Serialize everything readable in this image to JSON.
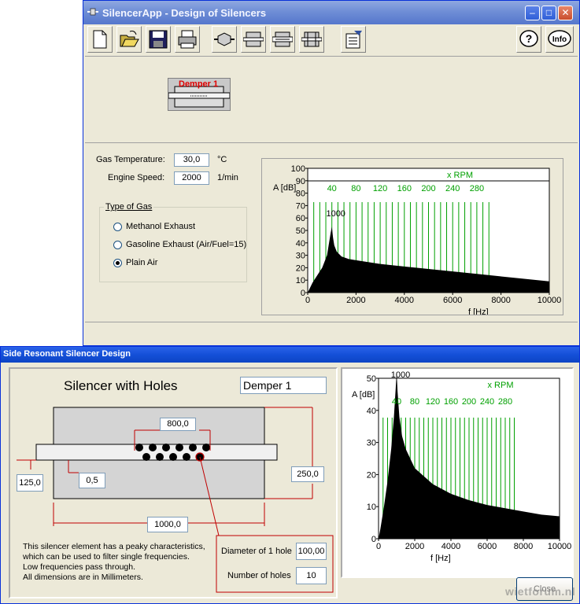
{
  "main_window": {
    "title": "SilencerApp - Design of Silencers",
    "title_icon": "silencer-app-icon",
    "controls": [
      "minimize-icon",
      "maximize-icon",
      "close-icon"
    ],
    "toolbar": [
      {
        "name": "new-file-icon"
      },
      {
        "name": "open-folder-icon"
      },
      {
        "name": "save-disk-icon"
      },
      {
        "name": "print-icon"
      },
      {
        "name": "silencer-cone-icon"
      },
      {
        "name": "silencer-element-1-icon"
      },
      {
        "name": "silencer-element-2-icon"
      },
      {
        "name": "silencer-element-3-icon"
      },
      {
        "name": "report-icon"
      },
      {
        "name": "help-icon",
        "label": "?"
      },
      {
        "name": "info-icon",
        "label": "Info"
      }
    ],
    "element_label": "Demper 1",
    "gas_temperature_label": "Gas Temperature:",
    "gas_temperature_value": "30,0",
    "gas_temperature_unit": "°C",
    "engine_speed_label": "Engine Speed:",
    "engine_speed_value": "2000",
    "engine_speed_unit": "1/min",
    "gas_group": {
      "title": "Type of Gas",
      "options": [
        "Methanol Exhaust",
        "Gasoline Exhaust (Air/Fuel=15)",
        "Plain Air"
      ],
      "selected": "Plain Air"
    }
  },
  "dialog": {
    "title": "Side Resonant Silencer Design",
    "heading": "Silencer with Holes",
    "name_value": "Demper 1",
    "dimensions": {
      "hole_span": "800,0",
      "outer_diameter": "250,0",
      "pipe_offset": "125,0",
      "wall": "0,5",
      "length": "1000,0"
    },
    "description": [
      "This silencer element has a peaky characteristics,",
      "which can be used to filter single frequencies.",
      "Low frequencies pass through.",
      "All dimensions are in Millimeters."
    ],
    "hole_diameter_label": "Diameter of 1 hole",
    "hole_diameter_value": "100,00",
    "hole_count_label": "Number of holes",
    "hole_count_value": "10",
    "close_label": "Close",
    "watermark": "wietforum.nl"
  },
  "chart_data": [
    {
      "type": "area",
      "ylabel": "A [dB]",
      "xlabel": "f [Hz]",
      "xlim": [
        0,
        10000
      ],
      "ylim": [
        0,
        100
      ],
      "x_ticks": [
        0,
        2000,
        4000,
        6000,
        8000,
        10000
      ],
      "y_ticks": [
        0,
        10,
        20,
        30,
        40,
        50,
        60,
        70,
        80,
        90,
        100
      ],
      "secondary_axis_label": "x RPM",
      "secondary_ticks": [
        40,
        80,
        120,
        160,
        200,
        240,
        280
      ],
      "peak_label": "1000",
      "grid": true,
      "x": [
        0,
        200,
        400,
        600,
        800,
        900,
        950,
        1000,
        1050,
        1100,
        1200,
        1400,
        1700,
        2000,
        3000,
        4000,
        5000,
        6000,
        7000,
        8000,
        9000,
        10000
      ],
      "y": [
        0,
        8,
        14,
        20,
        30,
        42,
        48,
        53,
        44,
        38,
        33,
        29,
        27,
        26,
        23,
        21,
        19,
        17,
        15,
        13,
        11,
        9
      ]
    },
    {
      "type": "area",
      "ylabel": "A [dB]",
      "xlabel": "f [Hz]",
      "xlim": [
        0,
        10000
      ],
      "ylim": [
        0,
        50
      ],
      "x_ticks": [
        0,
        2000,
        4000,
        6000,
        8000,
        10000
      ],
      "y_ticks": [
        0,
        10,
        20,
        30,
        40,
        50
      ],
      "secondary_axis_label": "x RPM",
      "secondary_ticks": [
        40,
        80,
        120,
        160,
        200,
        240,
        280
      ],
      "peak_label": "1000",
      "grid": true,
      "x": [
        0,
        100,
        300,
        500,
        700,
        850,
        950,
        1000,
        1050,
        1150,
        1300,
        1500,
        2000,
        3000,
        4000,
        5000,
        6000,
        7000,
        8000,
        9000,
        10000
      ],
      "y": [
        0,
        3,
        10,
        18,
        28,
        38,
        47,
        52,
        46,
        38,
        32,
        28,
        22,
        17,
        14,
        12,
        10.5,
        9.5,
        8.5,
        7.5,
        7
      ]
    }
  ]
}
